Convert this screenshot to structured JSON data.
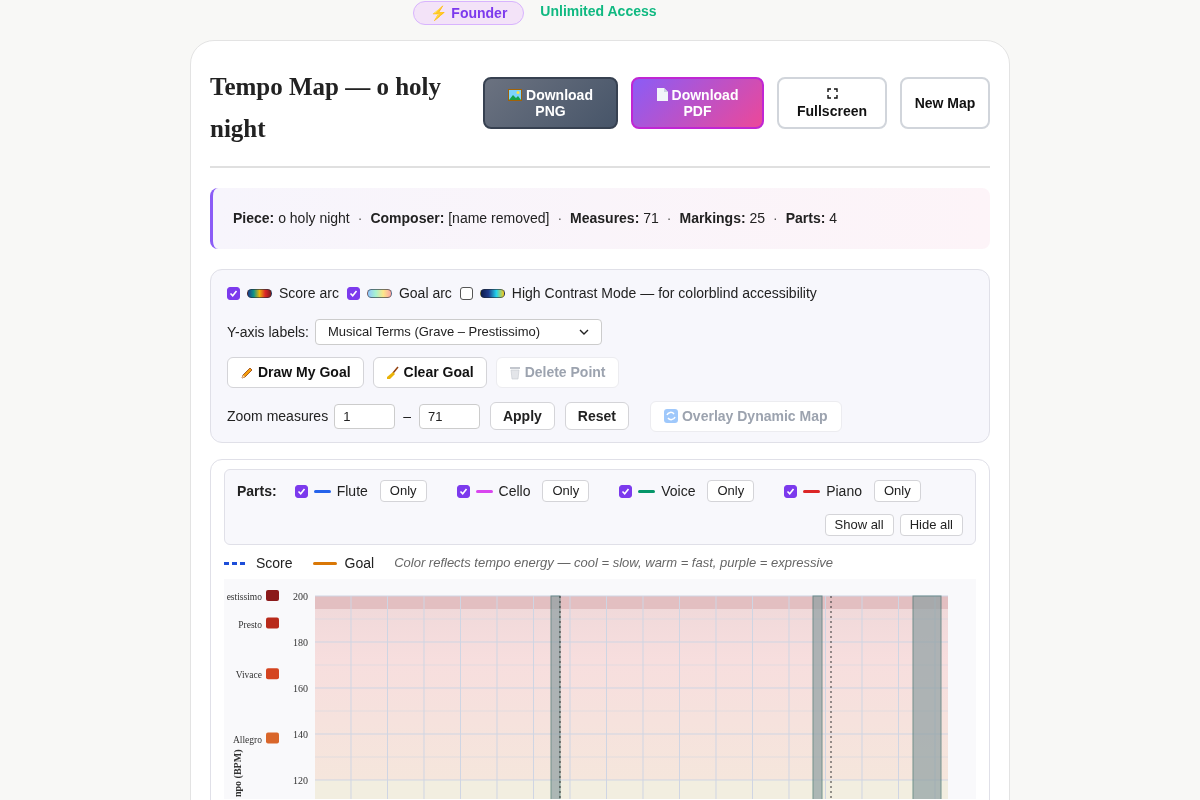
{
  "top_bar": {
    "badge": "⚡ Founder",
    "access": "Unlimited Access"
  },
  "header": {
    "title": "Tempo Map — o holy night",
    "buttons": [
      {
        "kind": "png",
        "label": "Download PNG"
      },
      {
        "kind": "pdf",
        "label": "Download PDF"
      },
      {
        "kind": "fullscreen",
        "label": "Fullscreen"
      },
      {
        "kind": "plain",
        "label": "New Map"
      }
    ]
  },
  "info": [
    {
      "label": "Piece:",
      "value": "o holy night"
    },
    {
      "label": "Composer:",
      "value": "[name removed]"
    },
    {
      "label": "Measures:",
      "value": "71"
    },
    {
      "label": "Markings:",
      "value": "25"
    },
    {
      "label": "Parts:",
      "value": "4"
    }
  ],
  "info_separator": "·",
  "toggles": [
    {
      "kind": "score",
      "label": "Score arc",
      "checked": true
    },
    {
      "kind": "goal",
      "label": "Goal arc",
      "checked": true
    },
    {
      "kind": "contrast",
      "label": "High Contrast Mode — for colorblind accessibility",
      "checked": false
    }
  ],
  "y_axis_labels": {
    "label": "Y-axis labels:",
    "value": "Musical Terms (Grave – Prestissimo)"
  },
  "goal_buttons": [
    {
      "kind": "pencil",
      "label": "Draw My Goal",
      "disabled": false
    },
    {
      "kind": "broom",
      "label": "Clear Goal",
      "disabled": false
    },
    {
      "kind": "trash",
      "label": "Delete Point",
      "disabled": true
    }
  ],
  "zoom": {
    "label": "Zoom measures",
    "from": "1",
    "dash": "–",
    "to": "71",
    "apply": "Apply",
    "reset": "Reset",
    "overlay": {
      "label": "Overlay Dynamic Map",
      "disabled": true
    }
  },
  "parts": {
    "label": "Parts:",
    "items": [
      {
        "name": "Flute",
        "color": "#2563eb",
        "checked": true,
        "only": "Only"
      },
      {
        "name": "Cello",
        "color": "#d946ef",
        "checked": true,
        "only": "Only"
      },
      {
        "name": "Voice",
        "color": "#059669",
        "checked": true,
        "only": "Only"
      },
      {
        "name": "Piano",
        "color": "#dc2626",
        "checked": true,
        "only": "Only"
      }
    ],
    "show_all": "Show all",
    "hide_all": "Hide all"
  },
  "legend": {
    "score": "Score",
    "goal": "Goal",
    "note": "Color reflects tempo energy — cool = slow, warm = fast, purple = expressive"
  },
  "chart": {
    "axis_title": "npo (BPM)",
    "terms": [
      {
        "label": "estissimo",
        "color": "#8b1a1a"
      },
      {
        "label": "Presto",
        "color": "#b82a1a"
      },
      {
        "label": "Vivace",
        "color": "#d4441f"
      },
      {
        "label": "Allegro",
        "color": "#d9662a"
      }
    ],
    "ticks": [
      "200",
      "180",
      "160",
      "140",
      "120"
    ]
  }
}
